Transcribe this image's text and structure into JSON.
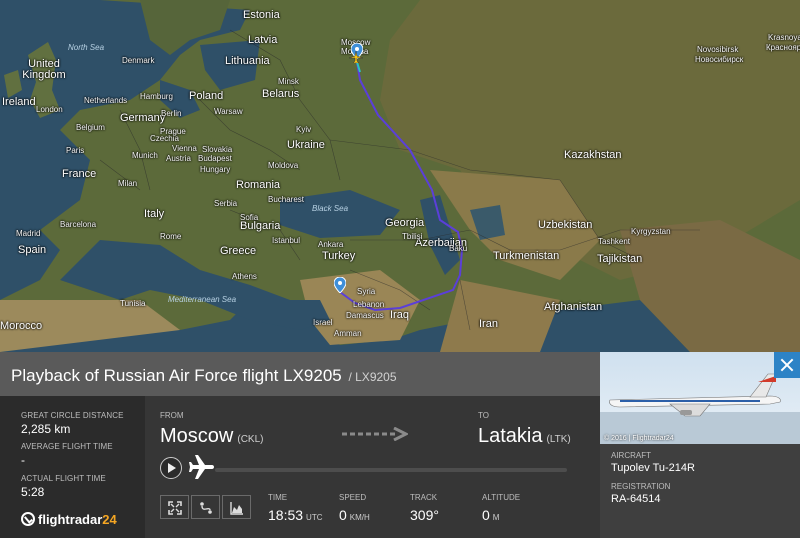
{
  "map": {
    "countries": [
      "Estonia",
      "Latvia",
      "Lithuania",
      "Belarus",
      "Poland",
      "Germany",
      "Netherlands",
      "Belgium",
      "United Kingdom",
      "Ireland",
      "France",
      "Spain",
      "Italy",
      "Austria",
      "Hungary",
      "Romania",
      "Bulgaria",
      "Serbia",
      "Slovakia",
      "Moldova",
      "Ukraine",
      "Greece",
      "Turkey",
      "Georgia",
      "Azerbaijan",
      "Syria",
      "Lebanon",
      "Iraq",
      "Israel",
      "Iran",
      "Kazakhstan",
      "Uzbekistan",
      "Turkmenistan",
      "Kyrgyzstan",
      "Tajikistan",
      "Afghanistan",
      "Tunisia",
      "Morocco",
      "Denmark",
      "Czechia"
    ],
    "cities": [
      "Moscow",
      "Москва",
      "Berlin",
      "Prague",
      "Vienna",
      "Budapest",
      "Warsaw",
      "Kyiv",
      "Rome",
      "Madrid",
      "Barcelona",
      "Athens",
      "Istanbul",
      "Ankara",
      "Bucharest",
      "Sofia",
      "Paris",
      "London",
      "Novosibirsk",
      "Новосибирск",
      "Krasnoyarsk",
      "Красноярск",
      "Tashkent",
      "Tbilisi",
      "Baku",
      "Damascus",
      "Amman",
      "Milan",
      "Munich",
      "Hamburg",
      "Minsk"
    ],
    "seas": [
      "North Sea",
      "Black Sea",
      "Mediterranean Sea"
    ],
    "route_color": "#5b3fd9",
    "origin_label": "Moscow",
    "destination_label": "Latakia"
  },
  "header": {
    "title": "Playback of Russian Air Force flight LX9205",
    "subtitle": "/ LX9205"
  },
  "stats": {
    "distance_label": "GREAT CIRCLE DISTANCE",
    "distance_value": "2,285 km",
    "avg_label": "AVERAGE FLIGHT TIME",
    "avg_value": "-",
    "actual_label": "ACTUAL FLIGHT TIME",
    "actual_value": "5:28",
    "logo_text": "flightradar",
    "logo_num": "24"
  },
  "flight": {
    "from_label": "FROM",
    "from_city": "Moscow",
    "from_code": "(CKL)",
    "to_label": "TO",
    "to_city": "Latakia",
    "to_code": "(LTK)",
    "time_label": "TIME",
    "time_value": "18:53",
    "time_unit": "UTC",
    "speed_label": "SPEED",
    "speed_value": "0",
    "speed_unit": "KM/H",
    "track_label": "TRACK",
    "track_value": "309°",
    "altitude_label": "ALTITUDE",
    "altitude_value": "0",
    "altitude_unit": "M",
    "playback_progress": 0
  },
  "aircraft": {
    "photo_credit": "© 2016 | Flightradar24",
    "aircraft_label": "AIRCRAFT",
    "aircraft_value": "Tupolev Tu-214R",
    "registration_label": "REGISTRATION",
    "registration_value": "RA-64514"
  },
  "colors": {
    "accent_blue": "#2d83c6",
    "route": "#5b3fd9",
    "brand_orange": "#f5a623"
  }
}
